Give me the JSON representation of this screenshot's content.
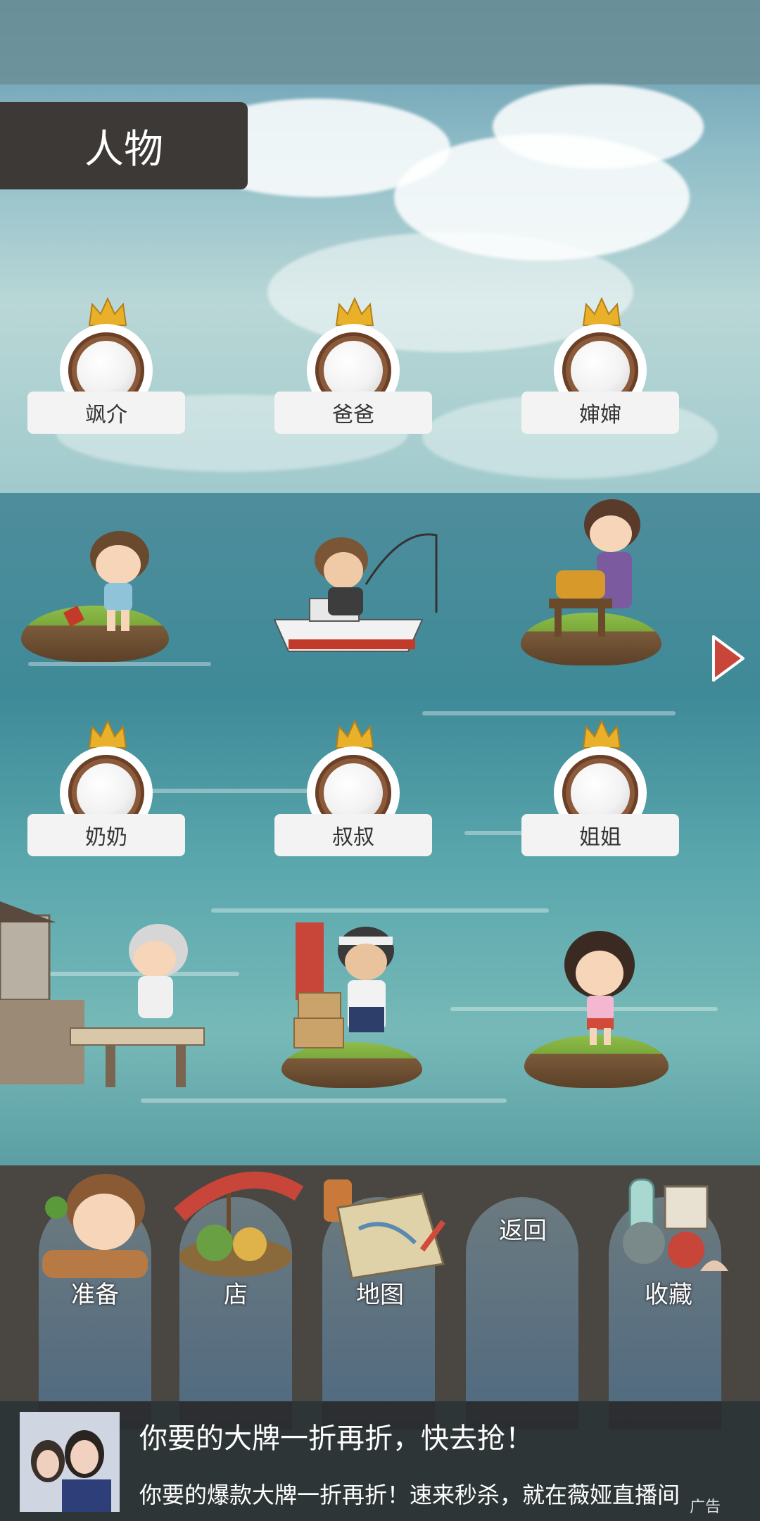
{
  "header": {
    "title": "人物"
  },
  "characters": [
    {
      "name": "飒介"
    },
    {
      "name": "爸爸"
    },
    {
      "name": "婶婶"
    },
    {
      "name": "奶奶"
    },
    {
      "name": "叔叔"
    },
    {
      "name": "姐姐"
    }
  ],
  "menu": [
    {
      "label": "准备",
      "icon": "boy-portrait-icon"
    },
    {
      "label": "店",
      "icon": "market-stall-icon"
    },
    {
      "label": "地图",
      "icon": "map-icon"
    },
    {
      "label": "返回",
      "icon": "back-icon"
    },
    {
      "label": "收藏",
      "icon": "collection-icon"
    }
  ],
  "ad": {
    "title": "你要的大牌一折再折，快去抢！",
    "subtitle": "你要的爆款大牌一折再折！速来秒杀，就在薇娅直播间",
    "tag": "广告"
  },
  "colors": {
    "title_tab": "#3d3936",
    "bottom_bar": "#4a4642",
    "arrow": "#c8453a"
  }
}
